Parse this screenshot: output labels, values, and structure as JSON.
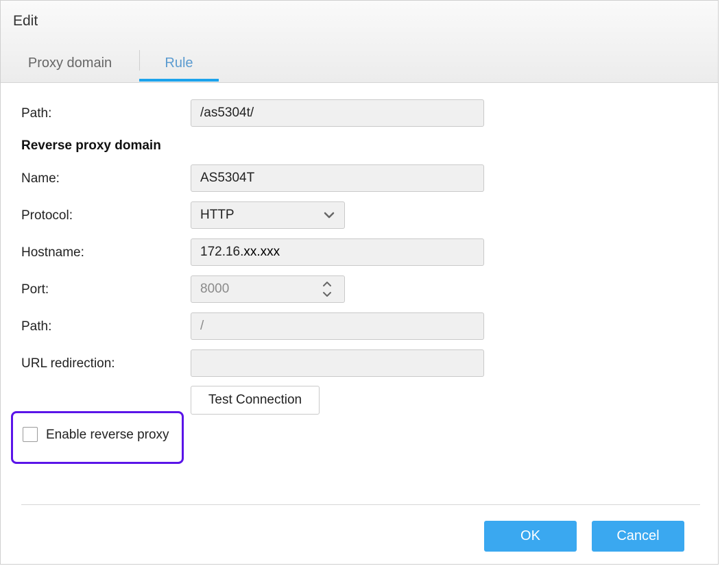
{
  "dialog": {
    "title": "Edit"
  },
  "tabs": [
    {
      "label": "Proxy domain",
      "active": false
    },
    {
      "label": "Rule",
      "active": true
    }
  ],
  "rule": {
    "path_label": "Path:",
    "path_value": "/as5304t/"
  },
  "reverse_proxy": {
    "section_title": "Reverse proxy domain",
    "name_label": "Name:",
    "name_value": "AS5304T",
    "protocol_label": "Protocol:",
    "protocol_value": "HTTP",
    "hostname_label": "Hostname:",
    "hostname_prefix": "172.16.",
    "hostname_masked": "xx.xxx",
    "port_label": "Port:",
    "port_value": "8000",
    "path_label": "Path:",
    "path_value": "/",
    "url_redirection_label": "URL redirection:",
    "url_redirection_value": ""
  },
  "test_connection_label": "Test Connection",
  "enable_reverse_proxy": {
    "label": "Enable reverse proxy",
    "checked": false
  },
  "footer": {
    "ok_label": "OK",
    "cancel_label": "Cancel"
  },
  "colors": {
    "accent": "#1ca3ec",
    "button_primary": "#3aa8f0",
    "highlight": "#5a14e8",
    "active_tab_text": "#5b9bd0"
  },
  "icons": {
    "protocol_dropdown": "chevron-down-icon",
    "port_spinner": "spinner-arrows-icon"
  }
}
